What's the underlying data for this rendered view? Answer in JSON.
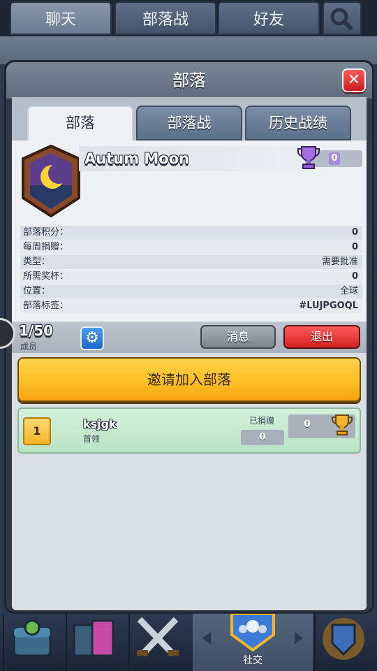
{
  "background": {
    "top_tabs": [
      "聊天",
      "部落战",
      "好友"
    ],
    "partial_name": "Autum Moon",
    "bottom_nav_label": "社交"
  },
  "modal": {
    "title": "部落",
    "tabs": [
      {
        "label": "部落",
        "active": true
      },
      {
        "label": "部落战",
        "active": false
      },
      {
        "label": "历史战绩",
        "active": false
      }
    ],
    "clan": {
      "name": "Autum Moon",
      "trophies": "0",
      "stats": [
        {
          "label": "部落积分：",
          "value": "0"
        },
        {
          "label": "每周捐赠：",
          "value": "0"
        },
        {
          "label": "类型：",
          "value": "需要批准"
        },
        {
          "label": "所需奖杯：",
          "value": "0"
        },
        {
          "label": "位置：",
          "value": "全球"
        },
        {
          "label": "部落标签：",
          "value": "#LUJPGOQL"
        }
      ]
    },
    "members_bar": {
      "count": "1/50",
      "count_label": "成员",
      "message_button": "消息",
      "leave_button": "退出"
    },
    "invite_button": "邀请加入部落",
    "members": [
      {
        "rank": "1",
        "name": "ksjgk",
        "role": "首领",
        "donated_label": "已捐赠",
        "donated": "0",
        "trophies": "0"
      }
    ]
  },
  "colors": {
    "accent_yellow": "#ffbf25",
    "leave_red": "#d42323",
    "member_green": "#c8ead0",
    "trophy_purple": "#8d5bd6"
  }
}
